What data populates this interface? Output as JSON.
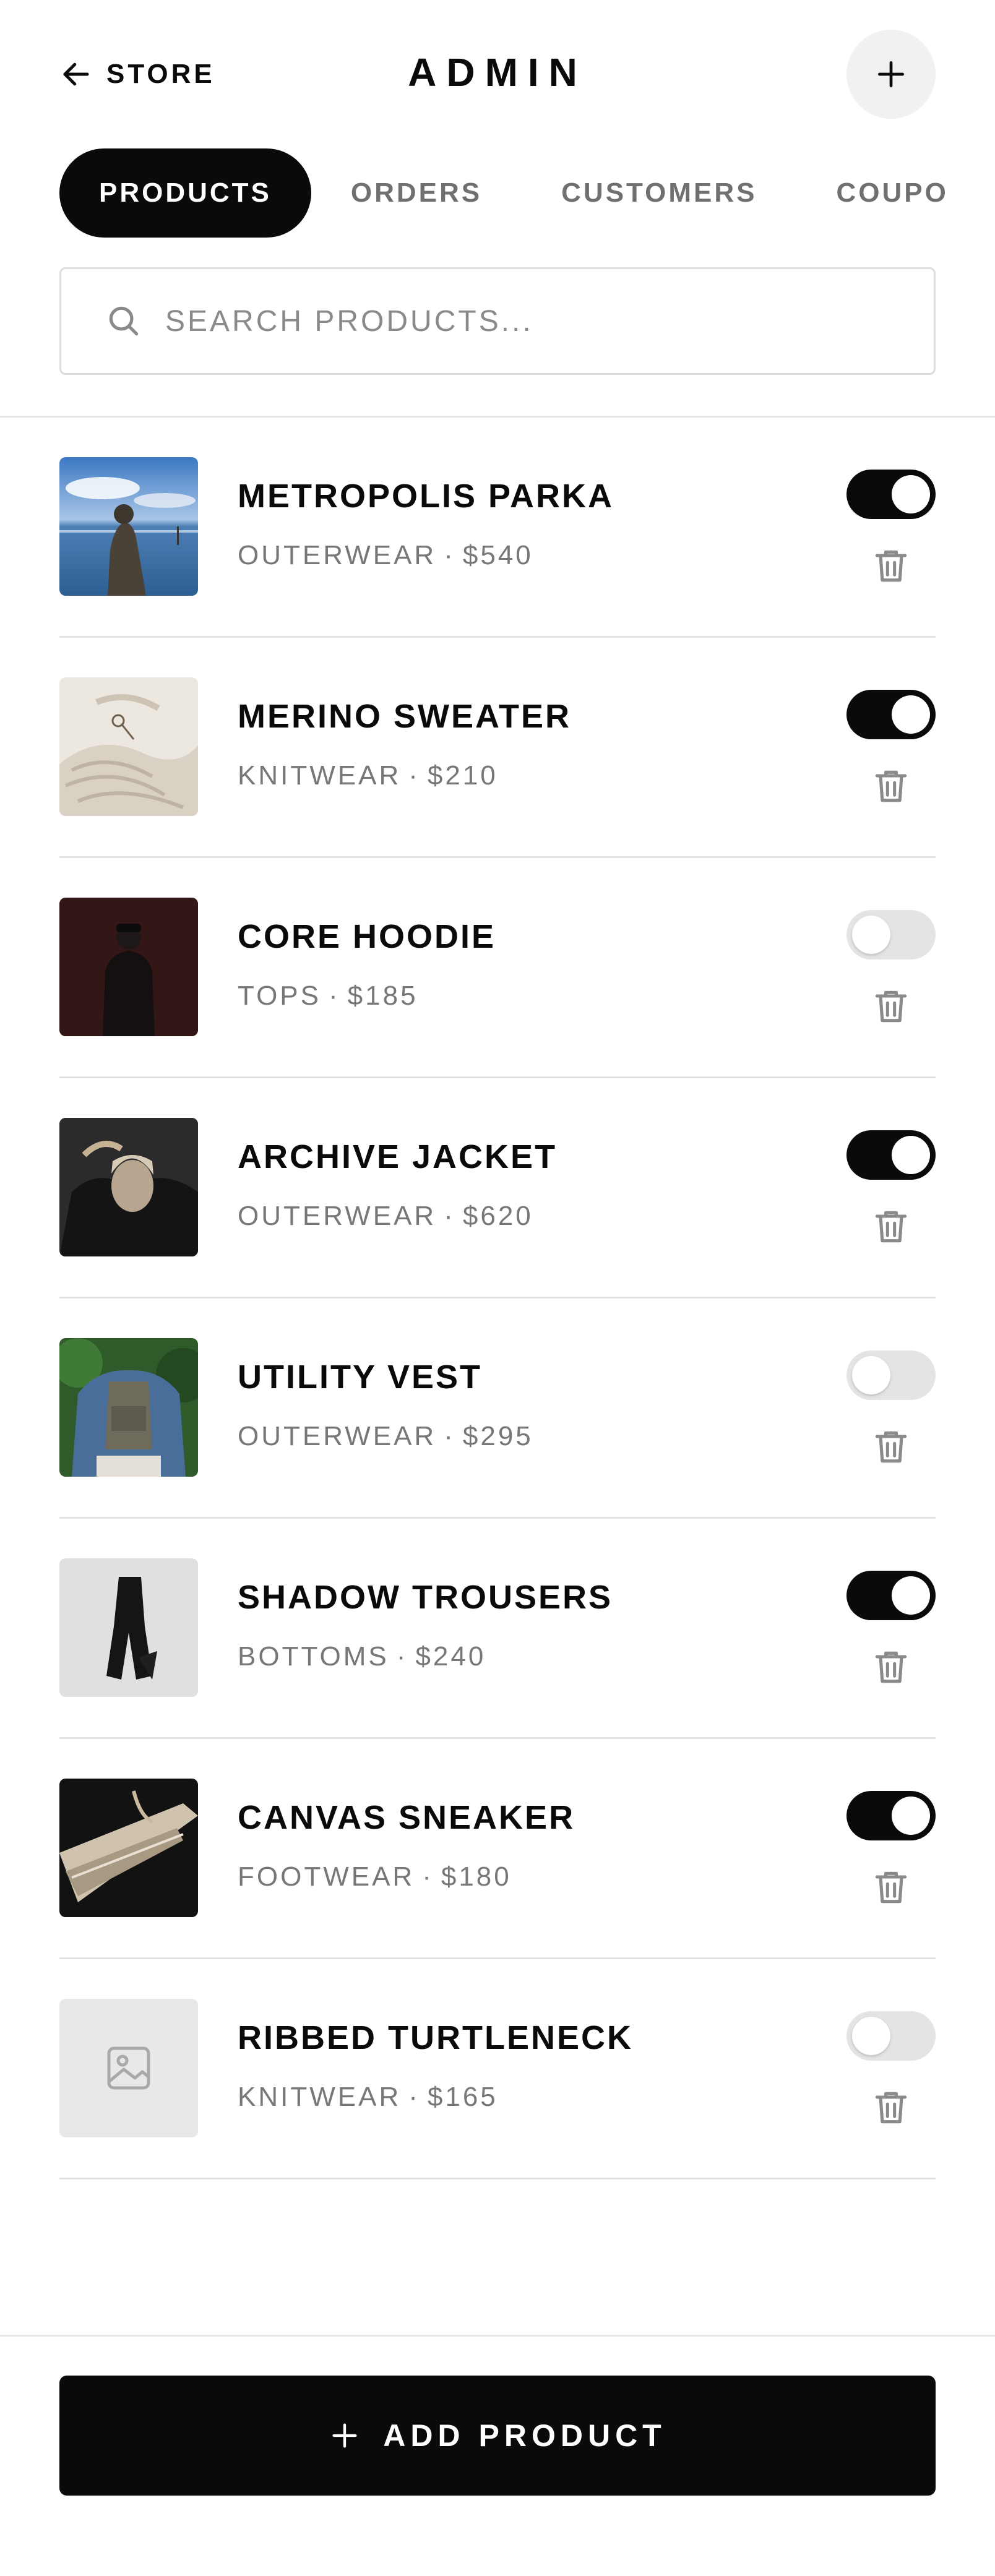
{
  "header": {
    "back_label": "STORE",
    "title": "ADMIN",
    "back_icon": "arrow-left-icon",
    "add_icon": "plus-icon"
  },
  "tabs": [
    {
      "label": "PRODUCTS",
      "active": true
    },
    {
      "label": "ORDERS",
      "active": false
    },
    {
      "label": "CUSTOMERS",
      "active": false
    },
    {
      "label": "COUPO",
      "active": false
    }
  ],
  "search": {
    "placeholder": "SEARCH PRODUCTS...",
    "value": ""
  },
  "products": [
    {
      "name": "METROPOLIS PARKA",
      "category": "OUTERWEAR",
      "price": "$540",
      "active": true
    },
    {
      "name": "MERINO SWEATER",
      "category": "KNITWEAR",
      "price": "$210",
      "active": true
    },
    {
      "name": "CORE HOODIE",
      "category": "TOPS",
      "price": "$185",
      "active": false
    },
    {
      "name": "ARCHIVE JACKET",
      "category": "OUTERWEAR",
      "price": "$620",
      "active": true
    },
    {
      "name": "UTILITY VEST",
      "category": "OUTERWEAR",
      "price": "$295",
      "active": false
    },
    {
      "name": "SHADOW TROUSERS",
      "category": "BOTTOMS",
      "price": "$240",
      "active": true
    },
    {
      "name": "CANVAS SNEAKER",
      "category": "FOOTWEAR",
      "price": "$180",
      "active": true
    },
    {
      "name": "RIBBED TURTLENECK",
      "category": "KNITWEAR",
      "price": "$165",
      "active": false
    }
  ],
  "footer": {
    "add_label": "ADD PRODUCT"
  },
  "colors": {
    "primary": "#0a0a0a",
    "muted_text": "#777777",
    "toggle_off": "#e4e4e4",
    "border": "#e2e2e2"
  }
}
